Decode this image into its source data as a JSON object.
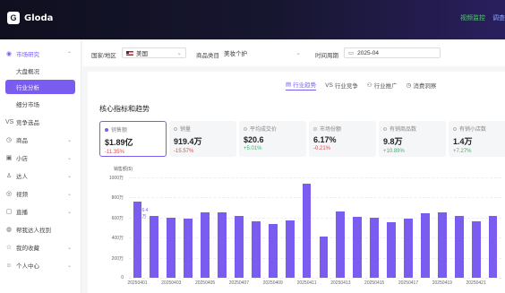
{
  "app": {
    "name": "Gloda",
    "logo_letter": "G"
  },
  "top_links": [
    "视频监控",
    "调查"
  ],
  "sidebar": {
    "items": [
      {
        "icon": "market-icon",
        "glyph": "◉",
        "label": "市场研究",
        "chevron": "⌃",
        "y": 0
      },
      {
        "label": "大盘概况",
        "sub": true
      },
      {
        "label": "行业分析",
        "sub": true,
        "active": true
      },
      {
        "label": "细分市场",
        "sub": true
      },
      {
        "icon": "vs-icon",
        "glyph": "VS",
        "label": "竞争选品"
      },
      {
        "icon": "product-icon",
        "glyph": "◷",
        "label": "商品",
        "chevron": "⌄"
      },
      {
        "icon": "shop-icon",
        "glyph": "▣",
        "label": "小店",
        "chevron": "⌄"
      },
      {
        "icon": "influencer-icon",
        "glyph": "♙",
        "label": "达人",
        "chevron": "⌄"
      },
      {
        "icon": "video-icon",
        "glyph": "◎",
        "label": "视频",
        "chevron": "⌄"
      },
      {
        "icon": "live-icon",
        "glyph": "▢",
        "label": "直播",
        "chevron": "⌄"
      },
      {
        "icon": "search-user-icon",
        "glyph": "◍",
        "label": "帮我达人找到"
      },
      {
        "icon": "star-icon",
        "glyph": "☆",
        "label": "我的收藏",
        "chevron": "⌄"
      },
      {
        "icon": "user-icon",
        "glyph": "☺",
        "label": "个人中心",
        "chevron": "⌄"
      }
    ]
  },
  "filters": {
    "country_label": "国家/地区",
    "country_value": "美国",
    "category_label": "商品类目",
    "category_value": "美妆个护",
    "period_label": "时间周期",
    "period_value": "2025-04"
  },
  "tabs": [
    {
      "icon": "trend-icon",
      "glyph": "▤",
      "label": "行业趋势",
      "active": true
    },
    {
      "icon": "compare-icon",
      "glyph": "VS",
      "label": "行业竞争"
    },
    {
      "icon": "ad-icon",
      "glyph": "⚇",
      "label": "行业推广"
    },
    {
      "icon": "consumer-icon",
      "glyph": "◷",
      "label": "消费洞察"
    }
  ],
  "section_title": "核心指标和趋势",
  "metrics": [
    {
      "label": "销售额",
      "value": "$1.89亿",
      "change": "-11.35%",
      "dir": "down",
      "selected": true
    },
    {
      "label": "销量",
      "value": "919.4万",
      "change": "-15.57%",
      "dir": "down"
    },
    {
      "label": "平均成交价",
      "value": "$20.6",
      "change": "+5.01%",
      "dir": "up"
    },
    {
      "label": "市场份额",
      "value": "6.17%",
      "change": "-0.21%",
      "dir": "down"
    },
    {
      "label": "有销商品数",
      "value": "9.8万",
      "change": "+10.89%",
      "dir": "up"
    },
    {
      "label": "有销小店数",
      "value": "1.4万",
      "change": "+7.27%",
      "dir": "up"
    }
  ],
  "chart_data": {
    "type": "bar",
    "ylabel": "销售额($)",
    "yticks": [
      "1000万",
      "800万",
      "600万",
      "400万",
      "200万",
      "0"
    ],
    "ylim": [
      0,
      1000
    ],
    "annotation": "6.4万",
    "categories": [
      "20250401",
      "20250402",
      "20250403",
      "20250404",
      "20250405",
      "20250406",
      "20250407",
      "20250408",
      "20250409",
      "20250410",
      "20250411",
      "20250412",
      "20250413",
      "20250414",
      "20250415",
      "20250416",
      "20250417",
      "20250418",
      "20250419",
      "20250420",
      "20250421",
      "20250422"
    ],
    "xtick_labels": [
      "20250401",
      "20250403",
      "20250405",
      "20250407",
      "20250409",
      "20250411",
      "20250413",
      "20250415",
      "20250417",
      "20250419",
      "20250421"
    ],
    "values": [
      760,
      620,
      600,
      590,
      650,
      650,
      620,
      560,
      540,
      570,
      940,
      410,
      660,
      610,
      600,
      550,
      590,
      640,
      650,
      620,
      560,
      620
    ],
    "color": "#7b5cf0"
  }
}
